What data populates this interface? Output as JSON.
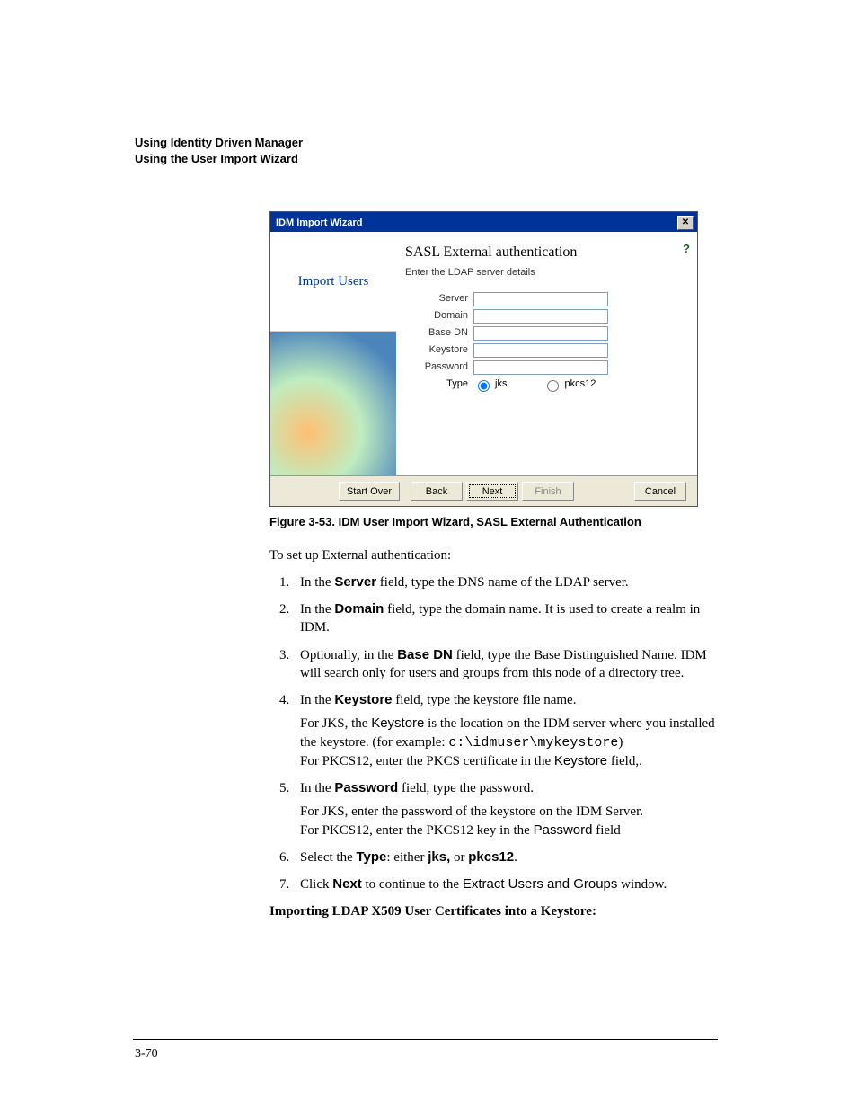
{
  "header": {
    "line1": "Using Identity Driven Manager",
    "line2": "Using the User Import Wizard"
  },
  "wizard": {
    "title": "IDM Import Wizard",
    "side_label": "Import Users",
    "heading": "SASL External authentication",
    "subheading": "Enter the LDAP server details",
    "fields": {
      "server_label": "Server",
      "server_value": "",
      "domain_label": "Domain",
      "domain_value": "",
      "basedn_label": "Base DN",
      "basedn_value": "",
      "keystore_label": "Keystore",
      "keystore_value": "",
      "password_label": "Password",
      "password_value": "",
      "type_label": "Type",
      "radio_jks": "jks",
      "radio_pkcs12": "pkcs12"
    },
    "buttons": {
      "start_over": "Start Over",
      "back": "Back",
      "next": "Next",
      "finish": "Finish",
      "cancel": "Cancel"
    }
  },
  "caption": "Figure 3-53. IDM User Import Wizard, SASL External Authentication",
  "intro": "To set up External authentication:",
  "steps": {
    "s1_a": "In the ",
    "s1_b": "Server",
    "s1_c": " field, type the DNS name of the LDAP server.",
    "s2_a": "In the ",
    "s2_b": "Domain",
    "s2_c": " field, type the domain name. It is used to create a realm in IDM.",
    "s3_a": "Optionally, in the ",
    "s3_b": "Base DN",
    "s3_c": " field, type the Base Distinguished Name. IDM will search only for users and groups from this node of a directory tree.",
    "s4_a": "In the ",
    "s4_b": "Keystore",
    "s4_c": " field, type the keystore file name.",
    "s4_p1_a": "For JKS, the ",
    "s4_p1_b": "Keystore",
    "s4_p1_c": " is the location on the IDM server where you installed the keystore. (for example: ",
    "s4_p1_code": "c:\\idmuser\\mykeystore",
    "s4_p1_d": ")",
    "s4_p2_a": "For PKCS12, enter the PKCS certificate in the ",
    "s4_p2_b": "Keystore",
    "s4_p2_c": " field,.",
    "s5_a": "In the ",
    "s5_b": "Password",
    "s5_c": " field, type the password.",
    "s5_p1": "For JKS, enter the password of the keystore on the IDM Server.",
    "s5_p2_a": "For PKCS12, enter the PKCS12 key in the ",
    "s5_p2_b": "Password",
    "s5_p2_c": " field",
    "s6_a": "Select the ",
    "s6_b": "Type",
    "s6_c": ": either ",
    "s6_d": "jks,",
    "s6_e": " or ",
    "s6_f": "pkcs12",
    "s6_g": ".",
    "s7_a": "Click ",
    "s7_b": "Next",
    "s7_c": " to continue to the ",
    "s7_d": "Extract Users and Groups",
    "s7_e": " window."
  },
  "subheading": "Importing LDAP X509 User Certificates into a Keystore:",
  "page_number": "3-70"
}
